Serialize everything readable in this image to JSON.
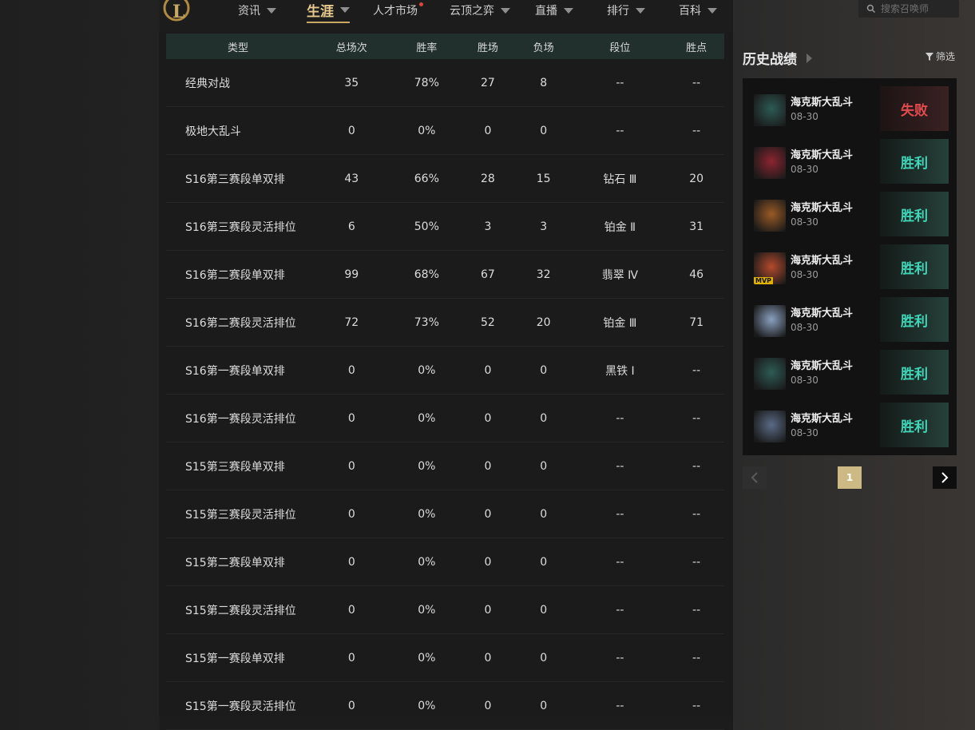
{
  "nav": {
    "items": [
      {
        "label": "资讯",
        "caret": true
      },
      {
        "label": "生涯",
        "caret": true,
        "active": true
      },
      {
        "label": "人才市场",
        "badge": true
      },
      {
        "label": "云顶之弈",
        "caret": true
      },
      {
        "label": "直播",
        "caret": true
      },
      {
        "label": "排行",
        "caret": true
      },
      {
        "label": "百科",
        "caret": true
      }
    ],
    "search_placeholder": "搜索召唤师",
    "logo_letter": "L"
  },
  "table": {
    "headers": [
      "类型",
      "总场次",
      "胜率",
      "胜场",
      "负场",
      "段位",
      "胜点"
    ],
    "rows": [
      [
        "经典对战",
        "35",
        "78%",
        "27",
        "8",
        "--",
        "--"
      ],
      [
        "极地大乱斗",
        "0",
        "0%",
        "0",
        "0",
        "--",
        "--"
      ],
      [
        "S16第三赛段单双排",
        "43",
        "66%",
        "28",
        "15",
        "钻石 Ⅲ",
        "20"
      ],
      [
        "S16第三赛段灵活排位",
        "6",
        "50%",
        "3",
        "3",
        "铂金 Ⅱ",
        "31"
      ],
      [
        "S16第二赛段单双排",
        "99",
        "68%",
        "67",
        "32",
        "翡翠 Ⅳ",
        "46"
      ],
      [
        "S16第二赛段灵活排位",
        "72",
        "73%",
        "52",
        "20",
        "铂金 Ⅲ",
        "71"
      ],
      [
        "S16第一赛段单双排",
        "0",
        "0%",
        "0",
        "0",
        "黑铁 Ⅰ",
        "--"
      ],
      [
        "S16第一赛段灵活排位",
        "0",
        "0%",
        "0",
        "0",
        "--",
        "--"
      ],
      [
        "S15第三赛段单双排",
        "0",
        "0%",
        "0",
        "0",
        "--",
        "--"
      ],
      [
        "S15第三赛段灵活排位",
        "0",
        "0%",
        "0",
        "0",
        "--",
        "--"
      ],
      [
        "S15第二赛段单双排",
        "0",
        "0%",
        "0",
        "0",
        "--",
        "--"
      ],
      [
        "S15第二赛段灵活排位",
        "0",
        "0%",
        "0",
        "0",
        "--",
        "--"
      ],
      [
        "S15第一赛段单双排",
        "0",
        "0%",
        "0",
        "0",
        "--",
        "--"
      ],
      [
        "S15第一赛段灵活排位",
        "0",
        "0%",
        "0",
        "0",
        "--",
        "--"
      ]
    ]
  },
  "history": {
    "title": "历史战绩",
    "filter_label": "筛选",
    "matches": [
      {
        "mode": "海克斯大乱斗",
        "date": "08-30",
        "result": "失败",
        "outcome": "lose",
        "avatar_color": "#2d5b55",
        "mvp": false
      },
      {
        "mode": "海克斯大乱斗",
        "date": "08-30",
        "result": "胜利",
        "outcome": "win",
        "avatar_color": "#8c2430",
        "mvp": false
      },
      {
        "mode": "海克斯大乱斗",
        "date": "08-30",
        "result": "胜利",
        "outcome": "win",
        "avatar_color": "#9a5a24",
        "mvp": false
      },
      {
        "mode": "海克斯大乱斗",
        "date": "08-30",
        "result": "胜利",
        "outcome": "win",
        "avatar_color": "#b44a2c",
        "mvp": true,
        "mvp_label": "MVP"
      },
      {
        "mode": "海克斯大乱斗",
        "date": "08-30",
        "result": "胜利",
        "outcome": "win",
        "avatar_color": "#8aa0c0",
        "mvp": false
      },
      {
        "mode": "海克斯大乱斗",
        "date": "08-30",
        "result": "胜利",
        "outcome": "win",
        "avatar_color": "#2d5b55",
        "mvp": false
      },
      {
        "mode": "海克斯大乱斗",
        "date": "08-30",
        "result": "胜利",
        "outcome": "win",
        "avatar_color": "#5a6a86",
        "mvp": false
      }
    ],
    "pagination": {
      "current": "1"
    }
  },
  "colors": {
    "accent_gold": "#c9a961",
    "win": "#3fd6b8",
    "lose": "#e24b4e"
  }
}
